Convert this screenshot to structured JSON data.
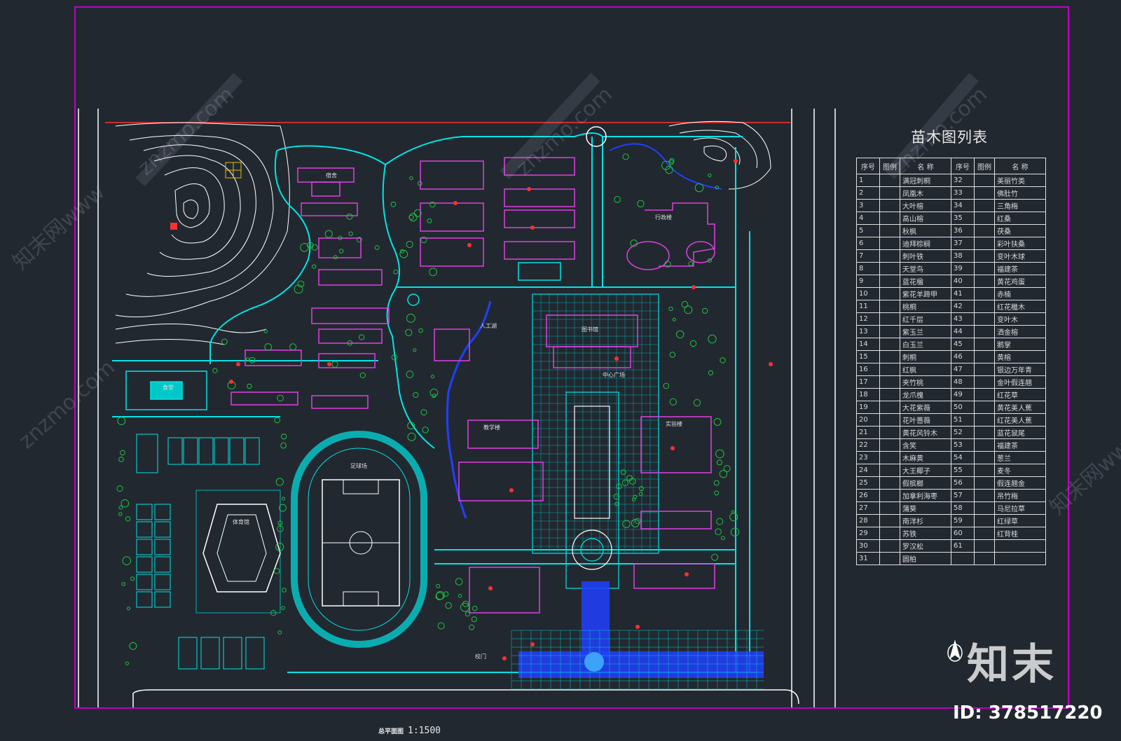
{
  "drawing": {
    "scale_caption": "总平面图",
    "scale": "1:1500",
    "watermark_brand": "知末",
    "watermark_id": "ID: 378517220",
    "watermark_site": "znzmo.com",
    "watermark_cn": "知末网www"
  },
  "legend": {
    "title": "苗木图列表",
    "headers": [
      "序号",
      "图例",
      "名  称",
      "序号",
      "图例",
      "名  称"
    ],
    "rows": [
      [
        "1",
        "",
        "满冠刺桐",
        "32",
        "",
        "美丽竹类"
      ],
      [
        "2",
        "",
        "凤凰木",
        "33",
        "",
        "佛肚竹"
      ],
      [
        "3",
        "",
        "大叶榕",
        "34",
        "",
        "三角梅"
      ],
      [
        "4",
        "",
        "高山榕",
        "35",
        "",
        "红桑"
      ],
      [
        "5",
        "",
        "秋枫",
        "36",
        "",
        "茯桑"
      ],
      [
        "6",
        "",
        "迪拜棕榈",
        "37",
        "",
        "彩叶扶桑"
      ],
      [
        "7",
        "",
        "刺叶铁",
        "38",
        "",
        "变叶木球"
      ],
      [
        "8",
        "",
        "天堂鸟",
        "39",
        "",
        "福建茶"
      ],
      [
        "9",
        "",
        "蓝花楹",
        "40",
        "",
        "黄花鸡蛋"
      ],
      [
        "10",
        "",
        "紫花羊蹄甲",
        "41",
        "",
        "赤楠"
      ],
      [
        "11",
        "",
        "桃桐",
        "42",
        "",
        "红花檵木"
      ],
      [
        "12",
        "",
        "红千层",
        "43",
        "",
        "变叶木"
      ],
      [
        "13",
        "",
        "紫玉兰",
        "44",
        "",
        "洒金榕"
      ],
      [
        "14",
        "",
        "白玉兰",
        "45",
        "",
        "鹅掌"
      ],
      [
        "15",
        "",
        "刺桐",
        "46",
        "",
        "黄榕"
      ],
      [
        "16",
        "",
        "红枫",
        "47",
        "",
        "银边万年青"
      ],
      [
        "17",
        "",
        "夹竹桃",
        "48",
        "",
        "金叶假连翘"
      ],
      [
        "18",
        "",
        "龙爪槐",
        "49",
        "",
        "红花草"
      ],
      [
        "19",
        "",
        "大花紫薇",
        "50",
        "",
        "黄花美人蕉"
      ],
      [
        "20",
        "",
        "花叶蔷薇",
        "51",
        "",
        "红花美人蕉"
      ],
      [
        "21",
        "",
        "黄花风铃木",
        "52",
        "",
        "蓝花鼠尾"
      ],
      [
        "22",
        "",
        "含笑",
        "53",
        "",
        "福建茶"
      ],
      [
        "23",
        "",
        "木麻黄",
        "54",
        "",
        "葱兰"
      ],
      [
        "24",
        "",
        "大王椰子",
        "55",
        "",
        "麦冬"
      ],
      [
        "25",
        "",
        "假槟榔",
        "56",
        "",
        "假连翘金"
      ],
      [
        "26",
        "",
        "加拿利海枣",
        "57",
        "",
        "吊竹梅"
      ],
      [
        "27",
        "",
        "蒲葵",
        "58",
        "",
        "马尼拉草"
      ],
      [
        "28",
        "",
        "南洋杉",
        "59",
        "",
        "红绿草"
      ],
      [
        "29",
        "",
        "苏铁",
        "60",
        "",
        "红背桂"
      ],
      [
        "30",
        "",
        "罗汉松",
        "61",
        "",
        ""
      ],
      [
        "31",
        "",
        "圆柏",
        "",
        "",
        ""
      ]
    ]
  },
  "colors": {
    "background": "#222830",
    "frame": "#c000c0",
    "primary_line": "#00e5e5",
    "building": "#e040e0",
    "road": "#ffffff",
    "water": "#2040ff",
    "tree_green": "#20c040",
    "highlight": "#ff3030"
  },
  "site_labels": {
    "gym": "体育馆",
    "track_field": "足球场",
    "library": "图书馆",
    "admin": "行政楼",
    "teaching_a": "教学楼",
    "teaching_b": "实验楼",
    "canteen": "食堂",
    "dorm": "宿舍",
    "lake": "人工湖",
    "plaza": "中心广场",
    "gate": "校门"
  }
}
